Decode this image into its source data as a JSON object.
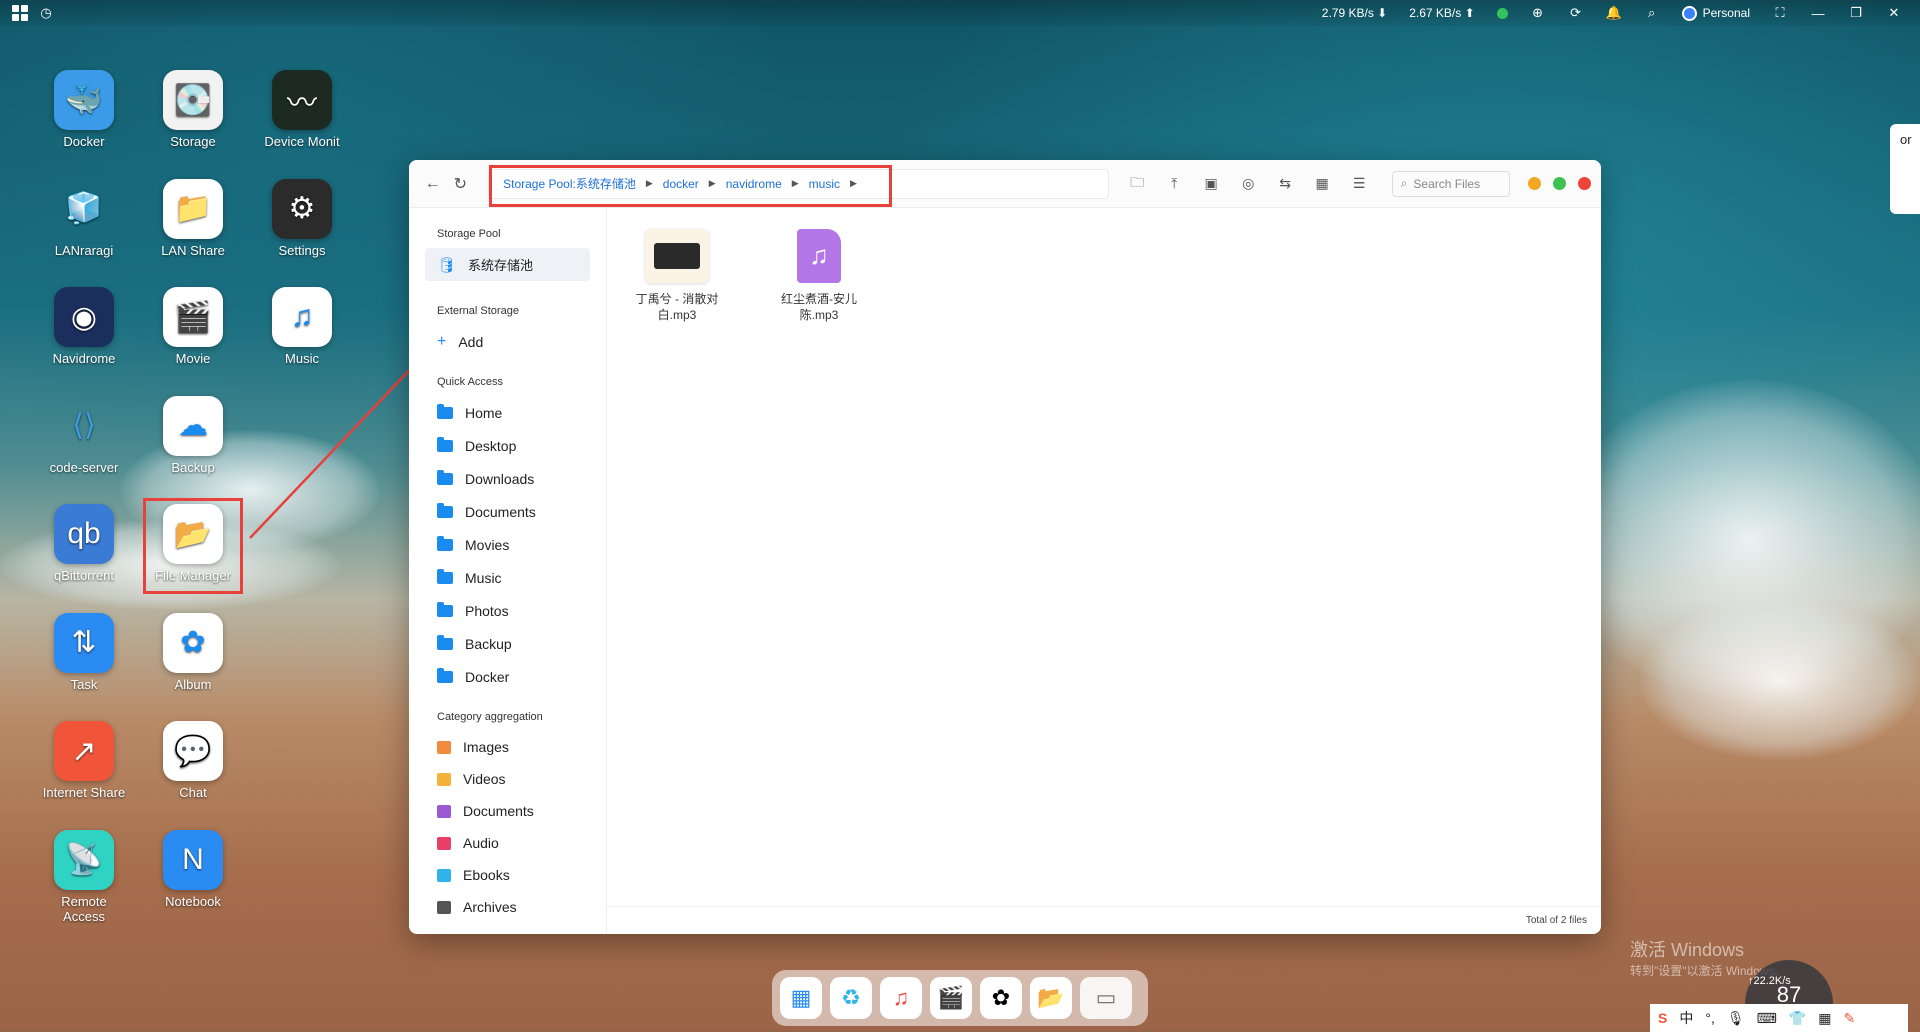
{
  "topbar": {
    "download_speed": "2.79 KB/s",
    "upload_speed": "2.67 KB/s",
    "user": "Personal"
  },
  "desktop_icons": [
    {
      "label": "Docker",
      "color": "#3b9be8",
      "glyph": "🐳"
    },
    {
      "label": "Storage",
      "color": "#f2f2f2",
      "glyph": "💽"
    },
    {
      "label": "Device Monit",
      "color": "#1c2a22",
      "glyph": "〰"
    },
    {
      "label": "LANraragi",
      "color": "transparent",
      "glyph": "🧊"
    },
    {
      "label": "LAN Share",
      "color": "#ffffff",
      "glyph": "📁"
    },
    {
      "label": "Settings",
      "color": "#2b2b2b",
      "glyph": "⚙"
    },
    {
      "label": "Navidrome",
      "color": "#1a2f5e",
      "glyph": "◉"
    },
    {
      "label": "Movie",
      "color": "#ffffff",
      "glyph": "🎬"
    },
    {
      "label": "Music",
      "color": "#ffffff",
      "glyph": "♫"
    },
    {
      "label": "code-server",
      "color": "transparent",
      "glyph": "⟨⟩"
    },
    {
      "label": "Backup",
      "color": "#ffffff",
      "glyph": "☁"
    },
    {
      "label": "qBittorrent",
      "color": "#3a7bd5",
      "glyph": "qb"
    },
    {
      "label": "File Manager",
      "color": "#ffffff",
      "glyph": "📂"
    },
    {
      "label": "Task",
      "color": "#2a8bf2",
      "glyph": "⇅"
    },
    {
      "label": "Album",
      "color": "#ffffff",
      "glyph": "✿"
    },
    {
      "label": "Internet Share",
      "color": "#f0553a",
      "glyph": "↗"
    },
    {
      "label": "Chat",
      "color": "#ffffff",
      "glyph": "💬"
    },
    {
      "label": "Remote Access",
      "color": "#2fd3c4",
      "glyph": "📡"
    },
    {
      "label": "Notebook",
      "color": "#2a8bf2",
      "glyph": "N"
    }
  ],
  "window": {
    "breadcrumb": [
      "Storage Pool:系统存储池",
      "docker",
      "navidrome",
      "music"
    ],
    "search_placeholder": "Search Files",
    "sidebar": {
      "storage_pool_title": "Storage Pool",
      "storage_pool_item": "系统存储池",
      "external_title": "External Storage",
      "external_add": "Add",
      "quick_title": "Quick Access",
      "quick_items": [
        "Home",
        "Desktop",
        "Downloads",
        "Documents",
        "Movies",
        "Music",
        "Photos",
        "Backup",
        "Docker"
      ],
      "category_title": "Category aggregation",
      "category_items": [
        {
          "label": "Images",
          "color": "#f08a3c"
        },
        {
          "label": "Videos",
          "color": "#f4b23a"
        },
        {
          "label": "Documents",
          "color": "#9b59d6"
        },
        {
          "label": "Audio",
          "color": "#e8406a"
        },
        {
          "label": "Ebooks",
          "color": "#2fb3e8"
        },
        {
          "label": "Archives",
          "color": "#555555"
        }
      ]
    },
    "files": [
      {
        "name_line1": "丁禹兮 - 消散对",
        "name_line2": "白.mp3"
      },
      {
        "name_line1": "红尘煮酒-安儿",
        "name_line2": "陈.mp3"
      }
    ],
    "status": "Total of 2 files"
  },
  "watermark": {
    "line1": "激活 Windows",
    "line2": "转到\"设置\"以激活 Windows。"
  },
  "gauge": {
    "value": "87",
    "speed": "↑22.2K/s"
  },
  "ime": {
    "lang": "中"
  },
  "right_peek": "or"
}
